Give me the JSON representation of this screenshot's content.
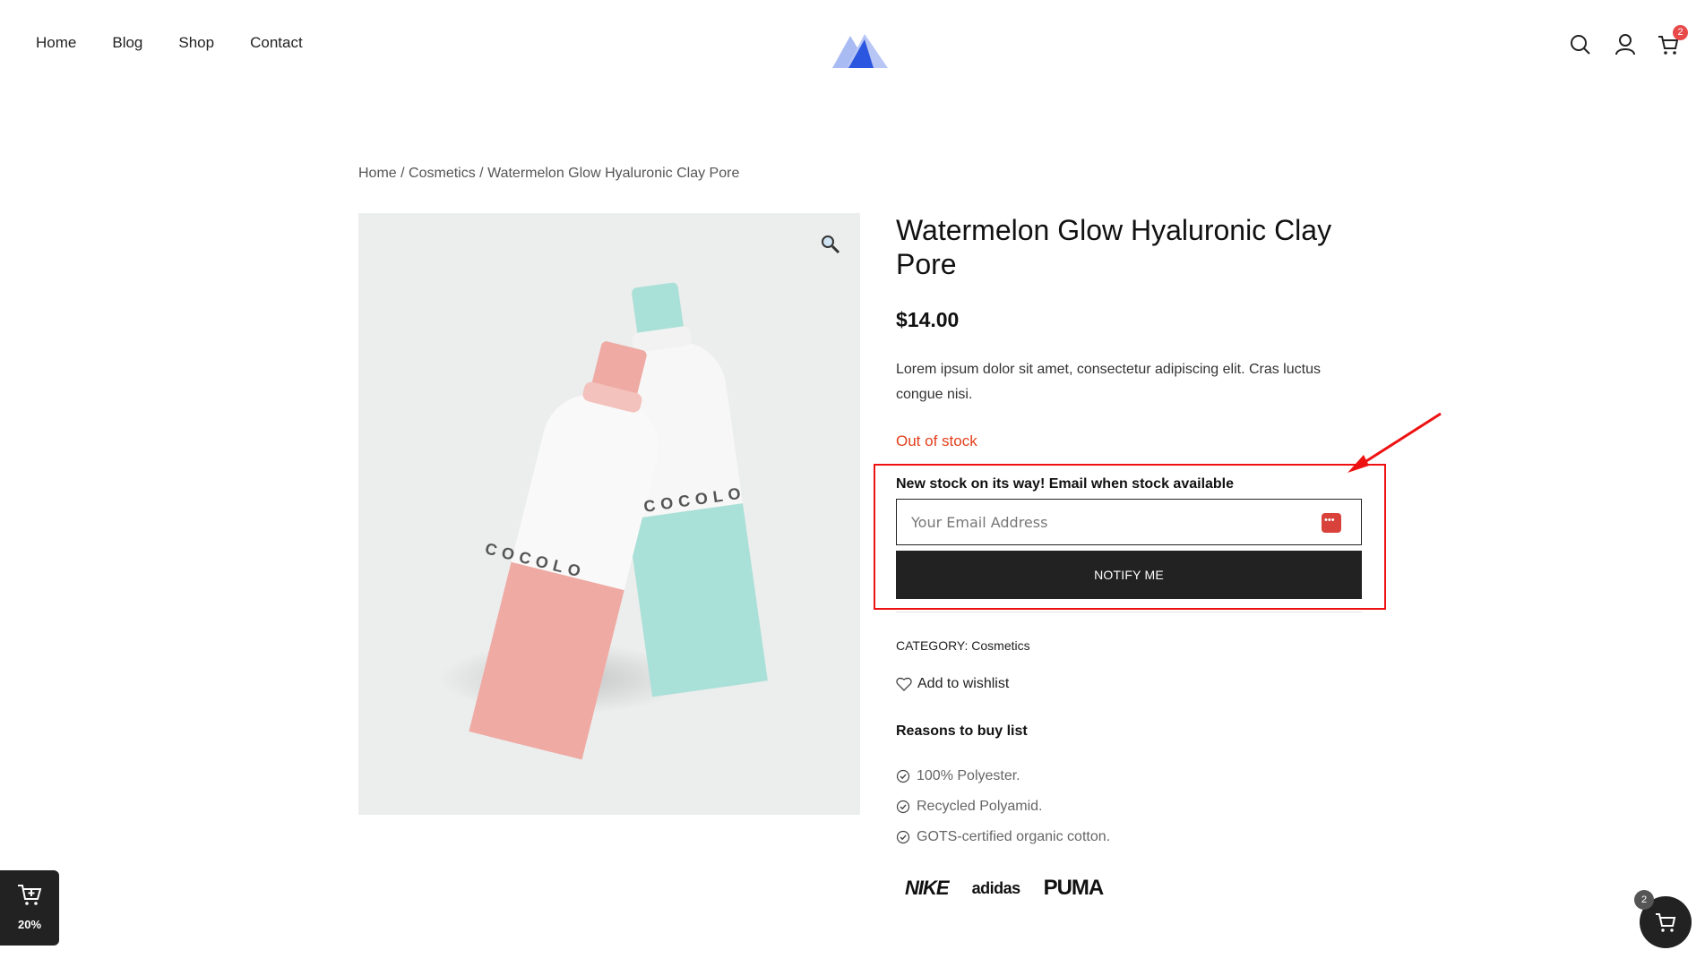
{
  "nav": {
    "items": [
      "Home",
      "Blog",
      "Shop",
      "Contact"
    ]
  },
  "header": {
    "cart_count": "2",
    "icons": [
      "search-icon",
      "user-icon",
      "cart-icon"
    ]
  },
  "breadcrumb": {
    "home": "Home",
    "sep1": " / ",
    "category": "Cosmetics",
    "sep2": " / ",
    "current": "Watermelon Glow Hyaluronic Clay Pore"
  },
  "product": {
    "title": "Watermelon Glow Hyaluronic Clay Pore",
    "price": "$14.00",
    "description": "Lorem ipsum dolor sit amet, consectetur adipiscing elit. Cras luctus congue nisi.",
    "stock_status": "Out of stock",
    "image_brand_1": "COCOLO",
    "image_brand_2": "COCOLO"
  },
  "notify": {
    "title": "New stock on its way! Email when stock available",
    "email_placeholder": "Your Email Address",
    "button_label": "NOTIFY ME"
  },
  "meta": {
    "category_label": "CATEGORY:",
    "category_value": "Cosmetics",
    "wishlist_label": "Add to wishlist"
  },
  "reasons": {
    "title": "Reasons to buy list",
    "items": [
      "100% Polyester.",
      "Recycled Polyamid.",
      "GOTS-certified organic cotton."
    ]
  },
  "brands": [
    "NIKE",
    "adidas",
    "PUMA"
  ],
  "widgets": {
    "discount": "20%",
    "cart_count": "2"
  },
  "colors": {
    "accent_red": "#e2401c",
    "annotation_red": "#e11111",
    "dark": "#222222",
    "logo_blue": "#2b57e0"
  }
}
